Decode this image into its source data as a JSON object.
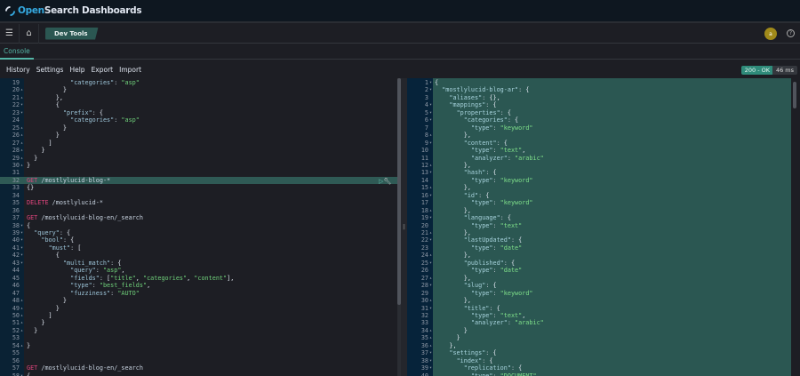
{
  "app": {
    "brand_open": "Open",
    "brand_rest": "Search Dashboards"
  },
  "nav": {
    "breadcrumb": "Dev Tools",
    "avatar_letter": "a",
    "help": "?"
  },
  "tabs": [
    {
      "label": "Console"
    }
  ],
  "menu": [
    "History",
    "Settings",
    "Help",
    "Export",
    "Import"
  ],
  "response": {
    "status": "200 - OK",
    "time": "46 ms"
  },
  "colors": {
    "accent": "#54b5a6",
    "response_bg": "#2b5752",
    "method": "#e0447c",
    "string": "#6fd07a"
  },
  "request_editor": {
    "active_line": 32,
    "lines": [
      {
        "n": "19",
        "f": "",
        "t": "            \"categories\": \"asp\""
      },
      {
        "n": "20",
        "f": "▴",
        "t": "          }"
      },
      {
        "n": "21",
        "f": "▴",
        "t": "        },"
      },
      {
        "n": "22",
        "f": "▾",
        "t": "        {"
      },
      {
        "n": "23",
        "f": "▾",
        "t": "          \"prefix\": {"
      },
      {
        "n": "24",
        "f": "",
        "t": "            \"categories\": \"asp\""
      },
      {
        "n": "25",
        "f": "▴",
        "t": "          }"
      },
      {
        "n": "26",
        "f": "▴",
        "t": "        }"
      },
      {
        "n": "27",
        "f": "▴",
        "t": "      ]"
      },
      {
        "n": "28",
        "f": "▴",
        "t": "    }"
      },
      {
        "n": "29",
        "f": "▴",
        "t": "  }"
      },
      {
        "n": "30",
        "f": "▴",
        "t": "}"
      },
      {
        "n": "31",
        "f": "",
        "t": ""
      },
      {
        "n": "32",
        "f": "",
        "t": "GET /mostlylucid-blog-*"
      },
      {
        "n": "33",
        "f": "",
        "t": "{}"
      },
      {
        "n": "34",
        "f": "",
        "t": ""
      },
      {
        "n": "35",
        "f": "",
        "t": "DELETE /mostlylucid-*"
      },
      {
        "n": "36",
        "f": "",
        "t": ""
      },
      {
        "n": "37",
        "f": "",
        "t": "GET /mostlylucid-blog-en/_search"
      },
      {
        "n": "38",
        "f": "▾",
        "t": "{"
      },
      {
        "n": "39",
        "f": "▾",
        "t": "  \"query\": {"
      },
      {
        "n": "40",
        "f": "▾",
        "t": "    \"bool\": {"
      },
      {
        "n": "41",
        "f": "▾",
        "t": "      \"must\": ["
      },
      {
        "n": "42",
        "f": "▾",
        "t": "        {"
      },
      {
        "n": "43",
        "f": "▾",
        "t": "          \"multi_match\": {"
      },
      {
        "n": "44",
        "f": "",
        "t": "            \"query\": \"asp\","
      },
      {
        "n": "45",
        "f": "",
        "t": "            \"fields\": [\"title\", \"categories\", \"content\"],"
      },
      {
        "n": "46",
        "f": "",
        "t": "            \"type\": \"best_fields\","
      },
      {
        "n": "47",
        "f": "",
        "t": "            \"fuzziness\": \"AUTO\""
      },
      {
        "n": "48",
        "f": "▴",
        "t": "          }"
      },
      {
        "n": "49",
        "f": "▴",
        "t": "        }"
      },
      {
        "n": "50",
        "f": "▴",
        "t": "      ]"
      },
      {
        "n": "51",
        "f": "▴",
        "t": "    }"
      },
      {
        "n": "52",
        "f": "▴",
        "t": "  }"
      },
      {
        "n": "53",
        "f": "",
        "t": ""
      },
      {
        "n": "54",
        "f": "▴",
        "t": "}"
      },
      {
        "n": "55",
        "f": "",
        "t": ""
      },
      {
        "n": "56",
        "f": "",
        "t": ""
      },
      {
        "n": "57",
        "f": "",
        "t": "GET /mostlylucid-blog-en/_search"
      },
      {
        "n": "58",
        "f": "▾",
        "t": "{"
      }
    ]
  },
  "response_editor": {
    "lines": [
      {
        "n": "1",
        "f": "▾",
        "t": "{"
      },
      {
        "n": "2",
        "f": "▾",
        "t": "  \"mostlylucid-blog-ar\": {"
      },
      {
        "n": "3",
        "f": "",
        "t": "    \"aliases\": {},"
      },
      {
        "n": "4",
        "f": "▾",
        "t": "    \"mappings\": {"
      },
      {
        "n": "5",
        "f": "▾",
        "t": "      \"properties\": {"
      },
      {
        "n": "6",
        "f": "▾",
        "t": "        \"categories\": {"
      },
      {
        "n": "7",
        "f": "",
        "t": "          \"type\": \"keyword\""
      },
      {
        "n": "8",
        "f": "▴",
        "t": "        },"
      },
      {
        "n": "9",
        "f": "▾",
        "t": "        \"content\": {"
      },
      {
        "n": "10",
        "f": "",
        "t": "          \"type\": \"text\","
      },
      {
        "n": "11",
        "f": "",
        "t": "          \"analyzer\": \"arabic\""
      },
      {
        "n": "12",
        "f": "▴",
        "t": "        },"
      },
      {
        "n": "13",
        "f": "▾",
        "t": "        \"hash\": {"
      },
      {
        "n": "14",
        "f": "",
        "t": "          \"type\": \"keyword\""
      },
      {
        "n": "15",
        "f": "▴",
        "t": "        },"
      },
      {
        "n": "16",
        "f": "▾",
        "t": "        \"id\": {"
      },
      {
        "n": "17",
        "f": "",
        "t": "          \"type\": \"keyword\""
      },
      {
        "n": "18",
        "f": "▴",
        "t": "        },"
      },
      {
        "n": "19",
        "f": "▾",
        "t": "        \"language\": {"
      },
      {
        "n": "20",
        "f": "",
        "t": "          \"type\": \"text\""
      },
      {
        "n": "21",
        "f": "▴",
        "t": "        },"
      },
      {
        "n": "22",
        "f": "▾",
        "t": "        \"lastUpdated\": {"
      },
      {
        "n": "23",
        "f": "",
        "t": "          \"type\": \"date\""
      },
      {
        "n": "24",
        "f": "▴",
        "t": "        },"
      },
      {
        "n": "25",
        "f": "▾",
        "t": "        \"published\": {"
      },
      {
        "n": "26",
        "f": "",
        "t": "          \"type\": \"date\""
      },
      {
        "n": "27",
        "f": "▴",
        "t": "        },"
      },
      {
        "n": "28",
        "f": "▾",
        "t": "        \"slug\": {"
      },
      {
        "n": "29",
        "f": "",
        "t": "          \"type\": \"keyword\""
      },
      {
        "n": "30",
        "f": "▴",
        "t": "        },"
      },
      {
        "n": "31",
        "f": "▾",
        "t": "        \"title\": {"
      },
      {
        "n": "32",
        "f": "",
        "t": "          \"type\": \"text\","
      },
      {
        "n": "33",
        "f": "",
        "t": "          \"analyzer\": \"arabic\""
      },
      {
        "n": "34",
        "f": "▴",
        "t": "        }"
      },
      {
        "n": "35",
        "f": "▴",
        "t": "      }"
      },
      {
        "n": "36",
        "f": "▴",
        "t": "    },"
      },
      {
        "n": "37",
        "f": "▾",
        "t": "    \"settings\": {"
      },
      {
        "n": "38",
        "f": "▾",
        "t": "      \"index\": {"
      },
      {
        "n": "39",
        "f": "▾",
        "t": "        \"replication\": {"
      },
      {
        "n": "40",
        "f": "",
        "t": "          \"type\": \"DOCUMENT\""
      }
    ]
  }
}
